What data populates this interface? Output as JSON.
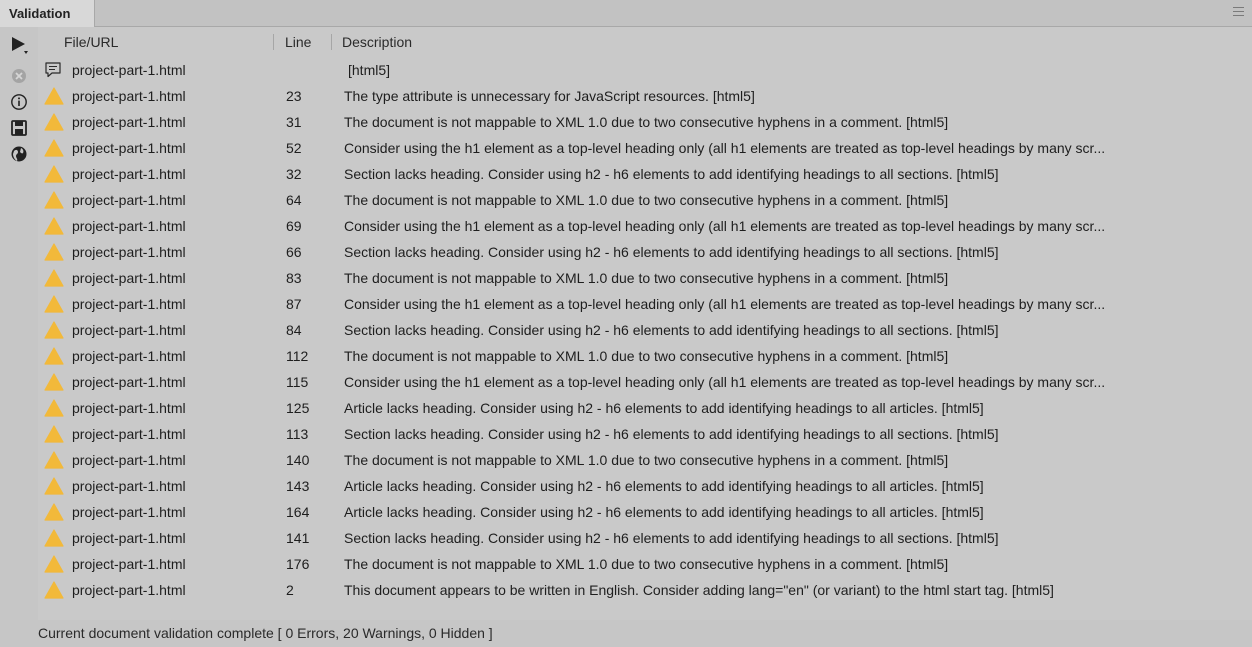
{
  "panel": {
    "tab_label": "Validation",
    "columns": {
      "file": "File/URL",
      "line": "Line",
      "description": "Description"
    },
    "status": "Current document validation complete [ 0 Errors, 20 Warnings, 0 Hidden ]"
  },
  "toolbar": {
    "run": "play-icon",
    "clear": "clear-icon",
    "info": "info-icon",
    "save": "save-icon",
    "browse": "globe-icon"
  },
  "colors": {
    "background": "#c6c6c6",
    "warning": "#f2b93a",
    "text": "#1e1e1e"
  },
  "rows": [
    {
      "icon": "message",
      "file": "project-part-1.html",
      "line": "",
      "desc": "[html5]"
    },
    {
      "icon": "warning",
      "file": "project-part-1.html",
      "line": "23",
      "desc": "The type attribute is unnecessary for JavaScript resources.  [html5]"
    },
    {
      "icon": "warning",
      "file": "project-part-1.html",
      "line": "31",
      "desc": "The document is not mappable to XML 1.0 due to two consecutive hyphens in a comment.  [html5]"
    },
    {
      "icon": "warning",
      "file": "project-part-1.html",
      "line": "52",
      "desc": "Consider using the h1 element as a top-level heading only (all h1 elements are treated as top-level headings by many scr..."
    },
    {
      "icon": "warning",
      "file": "project-part-1.html",
      "line": "32",
      "desc": "Section lacks heading. Consider using h2 - h6 elements to add identifying headings to all sections.  [html5]"
    },
    {
      "icon": "warning",
      "file": "project-part-1.html",
      "line": "64",
      "desc": "The document is not mappable to XML 1.0 due to two consecutive hyphens in a comment.  [html5]"
    },
    {
      "icon": "warning",
      "file": "project-part-1.html",
      "line": "69",
      "desc": "Consider using the h1 element as a top-level heading only (all h1 elements are treated as top-level headings by many scr..."
    },
    {
      "icon": "warning",
      "file": "project-part-1.html",
      "line": "66",
      "desc": "Section lacks heading. Consider using h2 - h6 elements to add identifying headings to all sections.  [html5]"
    },
    {
      "icon": "warning",
      "file": "project-part-1.html",
      "line": "83",
      "desc": "The document is not mappable to XML 1.0 due to two consecutive hyphens in a comment.  [html5]"
    },
    {
      "icon": "warning",
      "file": "project-part-1.html",
      "line": "87",
      "desc": "Consider using the h1 element as a top-level heading only (all h1 elements are treated as top-level headings by many scr..."
    },
    {
      "icon": "warning",
      "file": "project-part-1.html",
      "line": "84",
      "desc": "Section lacks heading. Consider using h2 - h6 elements to add identifying headings to all sections.  [html5]"
    },
    {
      "icon": "warning",
      "file": "project-part-1.html",
      "line": "112",
      "desc": "The document is not mappable to XML 1.0 due to two consecutive hyphens in a comment.  [html5]"
    },
    {
      "icon": "warning",
      "file": "project-part-1.html",
      "line": "115",
      "desc": "Consider using the h1 element as a top-level heading only (all h1 elements are treated as top-level headings by many scr..."
    },
    {
      "icon": "warning",
      "file": "project-part-1.html",
      "line": "125",
      "desc": "Article lacks heading. Consider using h2 - h6 elements to add identifying headings to all articles.  [html5]"
    },
    {
      "icon": "warning",
      "file": "project-part-1.html",
      "line": "113",
      "desc": "Section lacks heading. Consider using h2 - h6 elements to add identifying headings to all sections.  [html5]"
    },
    {
      "icon": "warning",
      "file": "project-part-1.html",
      "line": "140",
      "desc": "The document is not mappable to XML 1.0 due to two consecutive hyphens in a comment.  [html5]"
    },
    {
      "icon": "warning",
      "file": "project-part-1.html",
      "line": "143",
      "desc": "Article lacks heading. Consider using h2 - h6 elements to add identifying headings to all articles.  [html5]"
    },
    {
      "icon": "warning",
      "file": "project-part-1.html",
      "line": "164",
      "desc": "Article lacks heading. Consider using h2 - h6 elements to add identifying headings to all articles.  [html5]"
    },
    {
      "icon": "warning",
      "file": "project-part-1.html",
      "line": "141",
      "desc": "Section lacks heading. Consider using h2 - h6 elements to add identifying headings to all sections.  [html5]"
    },
    {
      "icon": "warning",
      "file": "project-part-1.html",
      "line": "176",
      "desc": "The document is not mappable to XML 1.0 due to two consecutive hyphens in a comment.  [html5]"
    },
    {
      "icon": "warning",
      "file": "project-part-1.html",
      "line": "2",
      "desc": "This document appears to be written in English. Consider adding lang=\"en\" (or variant) to the html start tag.  [html5]"
    }
  ]
}
